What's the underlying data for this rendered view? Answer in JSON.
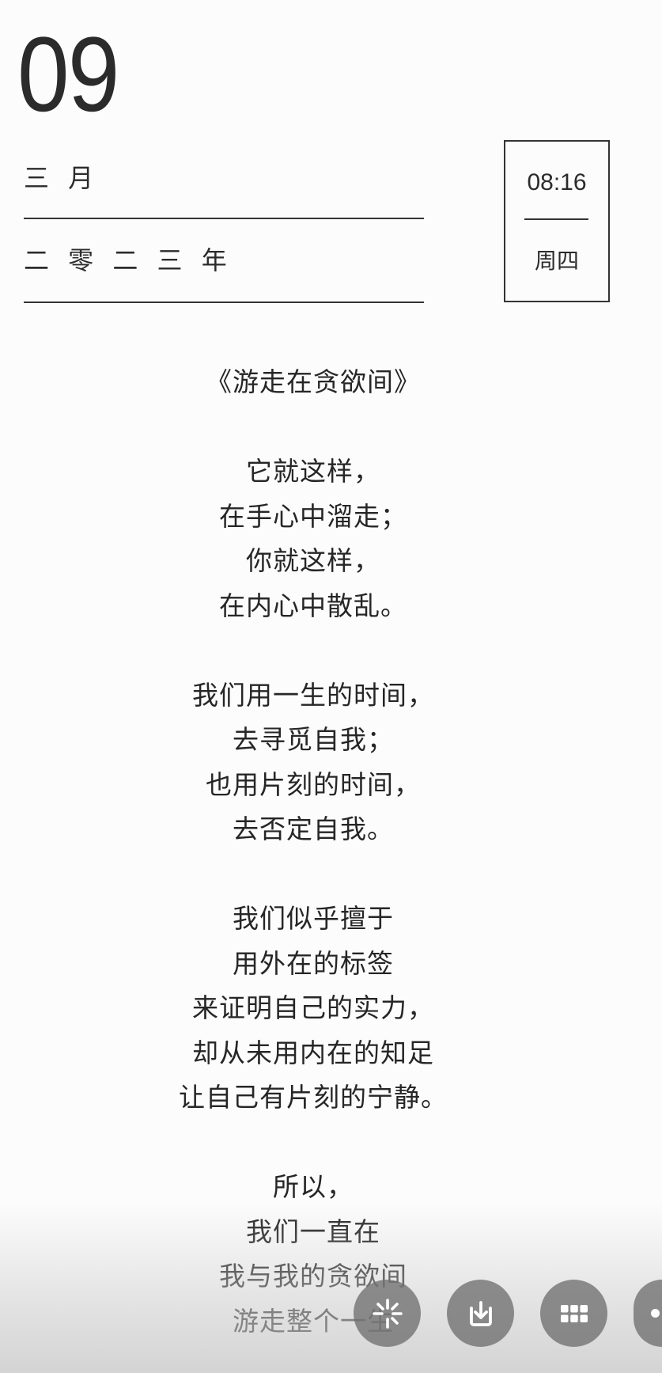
{
  "date": {
    "day": "09",
    "month": "三 月",
    "year": "二 零 二 三 年"
  },
  "clock": {
    "time": "08:16",
    "weekday": "周四"
  },
  "poem": {
    "title": "《游走在贪欲间》",
    "stanzas": [
      [
        "它就这样，",
        "在手心中溜走；",
        "你就这样，",
        "在内心中散乱。"
      ],
      [
        "我们用一生的时间，",
        "去寻觅自我；",
        "也用片刻的时间，",
        "去否定自我。"
      ],
      [
        "我们似乎擅于",
        "用外在的标签",
        "来证明自己的实力，",
        "却从未用内在的知足",
        "让自己有片刻的宁静。"
      ],
      [
        "所以，",
        "我们一直在",
        "我与我的贪欲间",
        "游走整个一生"
      ]
    ]
  },
  "toolbar": {
    "buttons": [
      {
        "icon": "sparkle-icon"
      },
      {
        "icon": "download-icon"
      },
      {
        "icon": "grid-icon"
      },
      {
        "icon": "more-icon"
      }
    ]
  },
  "colors": {
    "text": "#2b2b2b",
    "rule": "#333333",
    "background": "#fcfcfc",
    "button": "#707070"
  }
}
